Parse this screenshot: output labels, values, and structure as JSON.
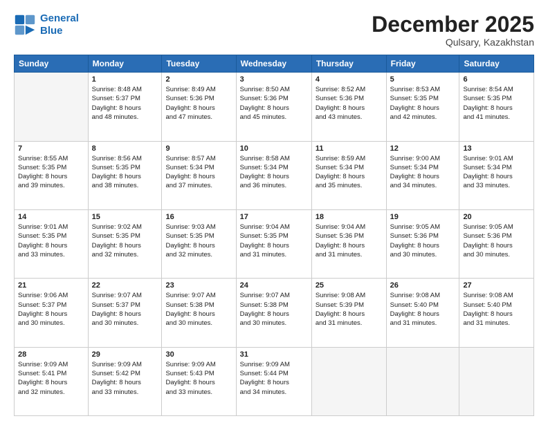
{
  "header": {
    "logo_line1": "General",
    "logo_line2": "Blue",
    "month": "December 2025",
    "location": "Qulsary, Kazakhstan"
  },
  "weekdays": [
    "Sunday",
    "Monday",
    "Tuesday",
    "Wednesday",
    "Thursday",
    "Friday",
    "Saturday"
  ],
  "weeks": [
    [
      {
        "day": "",
        "info": ""
      },
      {
        "day": "1",
        "info": "Sunrise: 8:48 AM\nSunset: 5:37 PM\nDaylight: 8 hours\nand 48 minutes."
      },
      {
        "day": "2",
        "info": "Sunrise: 8:49 AM\nSunset: 5:36 PM\nDaylight: 8 hours\nand 47 minutes."
      },
      {
        "day": "3",
        "info": "Sunrise: 8:50 AM\nSunset: 5:36 PM\nDaylight: 8 hours\nand 45 minutes."
      },
      {
        "day": "4",
        "info": "Sunrise: 8:52 AM\nSunset: 5:36 PM\nDaylight: 8 hours\nand 43 minutes."
      },
      {
        "day": "5",
        "info": "Sunrise: 8:53 AM\nSunset: 5:35 PM\nDaylight: 8 hours\nand 42 minutes."
      },
      {
        "day": "6",
        "info": "Sunrise: 8:54 AM\nSunset: 5:35 PM\nDaylight: 8 hours\nand 41 minutes."
      }
    ],
    [
      {
        "day": "7",
        "info": "Sunrise: 8:55 AM\nSunset: 5:35 PM\nDaylight: 8 hours\nand 39 minutes."
      },
      {
        "day": "8",
        "info": "Sunrise: 8:56 AM\nSunset: 5:35 PM\nDaylight: 8 hours\nand 38 minutes."
      },
      {
        "day": "9",
        "info": "Sunrise: 8:57 AM\nSunset: 5:34 PM\nDaylight: 8 hours\nand 37 minutes."
      },
      {
        "day": "10",
        "info": "Sunrise: 8:58 AM\nSunset: 5:34 PM\nDaylight: 8 hours\nand 36 minutes."
      },
      {
        "day": "11",
        "info": "Sunrise: 8:59 AM\nSunset: 5:34 PM\nDaylight: 8 hours\nand 35 minutes."
      },
      {
        "day": "12",
        "info": "Sunrise: 9:00 AM\nSunset: 5:34 PM\nDaylight: 8 hours\nand 34 minutes."
      },
      {
        "day": "13",
        "info": "Sunrise: 9:01 AM\nSunset: 5:34 PM\nDaylight: 8 hours\nand 33 minutes."
      }
    ],
    [
      {
        "day": "14",
        "info": "Sunrise: 9:01 AM\nSunset: 5:35 PM\nDaylight: 8 hours\nand 33 minutes."
      },
      {
        "day": "15",
        "info": "Sunrise: 9:02 AM\nSunset: 5:35 PM\nDaylight: 8 hours\nand 32 minutes."
      },
      {
        "day": "16",
        "info": "Sunrise: 9:03 AM\nSunset: 5:35 PM\nDaylight: 8 hours\nand 32 minutes."
      },
      {
        "day": "17",
        "info": "Sunrise: 9:04 AM\nSunset: 5:35 PM\nDaylight: 8 hours\nand 31 minutes."
      },
      {
        "day": "18",
        "info": "Sunrise: 9:04 AM\nSunset: 5:36 PM\nDaylight: 8 hours\nand 31 minutes."
      },
      {
        "day": "19",
        "info": "Sunrise: 9:05 AM\nSunset: 5:36 PM\nDaylight: 8 hours\nand 30 minutes."
      },
      {
        "day": "20",
        "info": "Sunrise: 9:05 AM\nSunset: 5:36 PM\nDaylight: 8 hours\nand 30 minutes."
      }
    ],
    [
      {
        "day": "21",
        "info": "Sunrise: 9:06 AM\nSunset: 5:37 PM\nDaylight: 8 hours\nand 30 minutes."
      },
      {
        "day": "22",
        "info": "Sunrise: 9:07 AM\nSunset: 5:37 PM\nDaylight: 8 hours\nand 30 minutes."
      },
      {
        "day": "23",
        "info": "Sunrise: 9:07 AM\nSunset: 5:38 PM\nDaylight: 8 hours\nand 30 minutes."
      },
      {
        "day": "24",
        "info": "Sunrise: 9:07 AM\nSunset: 5:38 PM\nDaylight: 8 hours\nand 30 minutes."
      },
      {
        "day": "25",
        "info": "Sunrise: 9:08 AM\nSunset: 5:39 PM\nDaylight: 8 hours\nand 31 minutes."
      },
      {
        "day": "26",
        "info": "Sunrise: 9:08 AM\nSunset: 5:40 PM\nDaylight: 8 hours\nand 31 minutes."
      },
      {
        "day": "27",
        "info": "Sunrise: 9:08 AM\nSunset: 5:40 PM\nDaylight: 8 hours\nand 31 minutes."
      }
    ],
    [
      {
        "day": "28",
        "info": "Sunrise: 9:09 AM\nSunset: 5:41 PM\nDaylight: 8 hours\nand 32 minutes."
      },
      {
        "day": "29",
        "info": "Sunrise: 9:09 AM\nSunset: 5:42 PM\nDaylight: 8 hours\nand 33 minutes."
      },
      {
        "day": "30",
        "info": "Sunrise: 9:09 AM\nSunset: 5:43 PM\nDaylight: 8 hours\nand 33 minutes."
      },
      {
        "day": "31",
        "info": "Sunrise: 9:09 AM\nSunset: 5:44 PM\nDaylight: 8 hours\nand 34 minutes."
      },
      {
        "day": "",
        "info": ""
      },
      {
        "day": "",
        "info": ""
      },
      {
        "day": "",
        "info": ""
      }
    ]
  ]
}
